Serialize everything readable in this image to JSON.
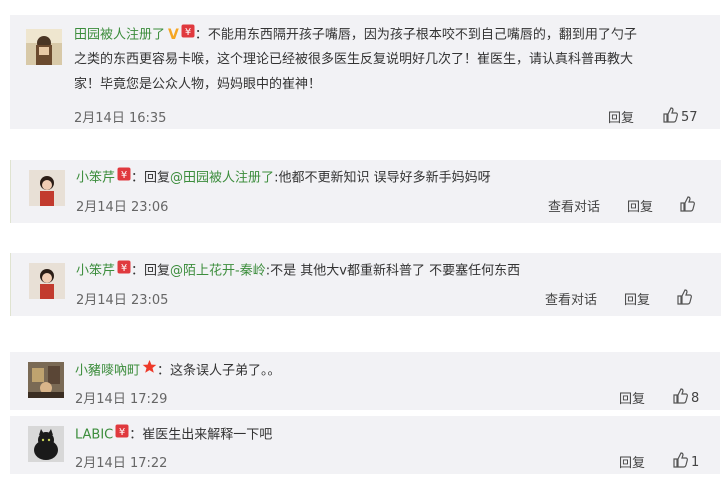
{
  "comments": [
    {
      "user": "田园被人注册了",
      "sep": "：",
      "line1": "不能用东西隔开孩子嘴唇，因为孩子根本咬不到自己嘴唇的，翻到用了勺子",
      "line2": "之类的东西更容易卡喉，这个理论已经被很多医生反复说明好几次了！崔医生，请认真科普再教大",
      "line3": "家！毕竟您是公众人物，妈妈眼中的崔神！",
      "time": "2月14日 16:35",
      "reply": "回复",
      "likes": "57"
    },
    {
      "user": "小笨芹",
      "sep": "：",
      "reply_prefix": "回复",
      "reply_to": "@田园被人注册了",
      "text": ":他都不更新知识 误导好多新手妈妈呀",
      "time": "2月14日 23:06",
      "view_conv": "查看对话",
      "reply": "回复"
    },
    {
      "user": "小笨芹",
      "sep": "：",
      "reply_prefix": "回复",
      "reply_to": "@陌上花开-秦岭",
      "text": ":不是 其他大v都重新科普了 不要塞任何东西",
      "time": "2月14日 23:05",
      "view_conv": "查看对话",
      "reply": "回复"
    },
    {
      "user": "小豬嘜吶町",
      "sep": "：",
      "text": "这条误人子弟了。。",
      "time": "2月14日 17:29",
      "reply": "回复",
      "likes": "8"
    },
    {
      "user": "LABIC",
      "sep": "：",
      "text": "崔医生出来解释一下吧",
      "time": "2月14日 17:22",
      "reply": "回复",
      "likes": "1"
    }
  ],
  "colors": {
    "link": "#3c8d3c",
    "card_bg": "#f2f2f5",
    "badge_red": "#e0393e",
    "v_gold": "#f5a623",
    "star": "#ee3a2a"
  }
}
